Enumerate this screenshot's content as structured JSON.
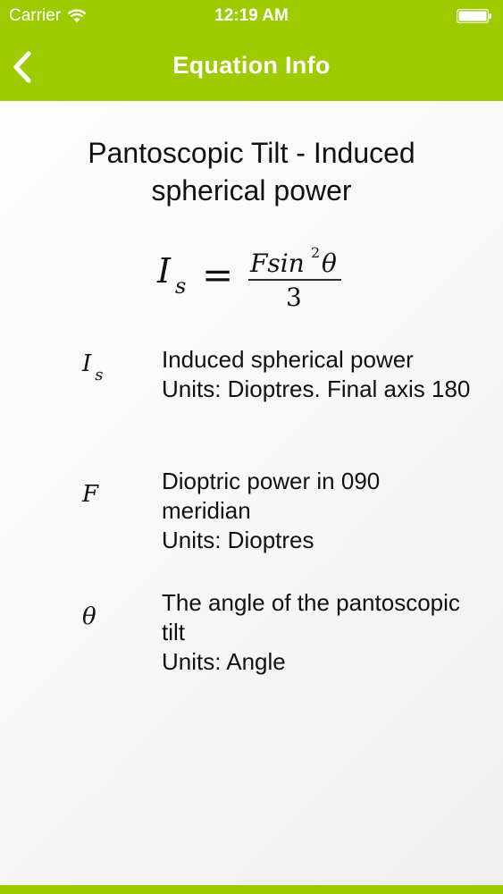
{
  "status": {
    "carrier": "Carrier",
    "time": "12:19 AM"
  },
  "nav": {
    "title": "Equation Info"
  },
  "header": {
    "title": "Pantoscopic Tilt - Induced spherical power"
  },
  "equation": {
    "lhs": "I",
    "lhs_sub": "s",
    "numerator": "Fsin",
    "numerator_sup": "2",
    "numerator_tail": "θ",
    "denominator": "3"
  },
  "variables": [
    {
      "symbol": "I",
      "sub": "s",
      "description": "Induced spherical power",
      "units": "Units: Dioptres. Final axis 180"
    },
    {
      "symbol": "F",
      "sub": "",
      "description": "Dioptric power in 090 meridian",
      "units": "Units: Dioptres"
    },
    {
      "symbol": "θ",
      "sub": "",
      "description": "The angle of the pantoscopic tilt",
      "units": "Units: Angle"
    }
  ]
}
